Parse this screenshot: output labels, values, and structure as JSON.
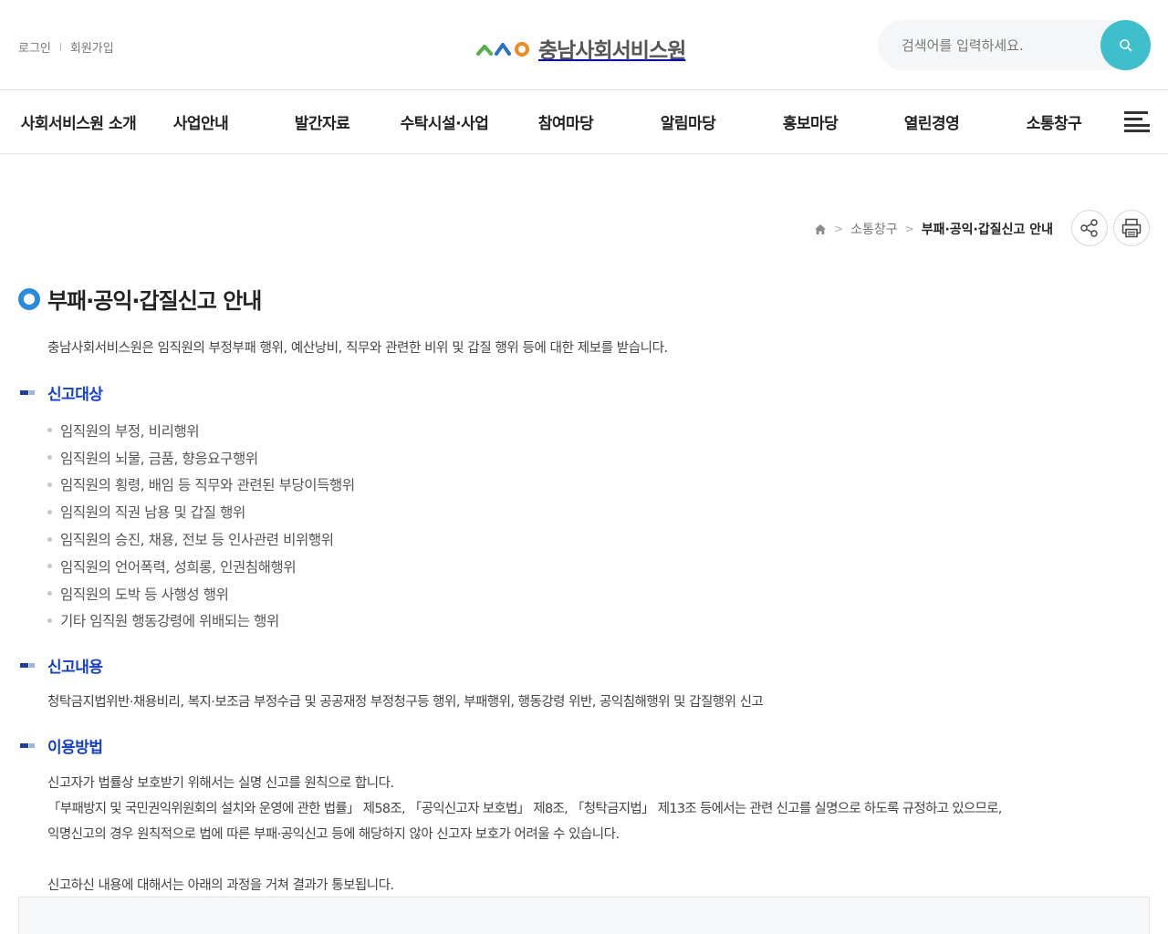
{
  "util": {
    "login": "로그인",
    "signup": "회원가입"
  },
  "logo": {
    "text": "충남사회서비스원",
    "colors": [
      "#55b04c",
      "#2b6fd0",
      "#f08a24"
    ]
  },
  "search": {
    "placeholder": "검색어를 입력하세요.",
    "value": "",
    "icon": "search-icon",
    "button_color": "#3fbfcc"
  },
  "gnb": {
    "items": [
      "사회서비스원 소개",
      "사업안내",
      "발간자료",
      "수탁시설·사업",
      "참여마당",
      "알림마당",
      "홍보마당",
      "열린경영",
      "소통창구"
    ],
    "menu_icon": "hamburger-icon"
  },
  "breadcrumb": {
    "home_icon": "home-icon",
    "parent": "소통창구",
    "current": "부패·공익·갑질신고 안내"
  },
  "tools": {
    "share_icon": "share-icon",
    "print_icon": "print-icon"
  },
  "page": {
    "title": "부패·공익·갑질신고 안내",
    "intro": "충남사회서비스원은 임직원의 부정부패 행위, 예산낭비, 직무와 관련한 비위 및 갑질 행위 등에 대한 제보를 받습니다."
  },
  "sections": {
    "targets": {
      "title": "신고대상",
      "items": [
        "임직원의 부정, 비리행위",
        "임직원의 뇌물, 금품, 향응요구행위",
        "임직원의 횡령, 배임 등 직무와 관련된 부당이득행위",
        "임직원의 직권 남용 및 갑질 행위",
        "임직원의 승진, 채용, 전보 등 인사관련 비위행위",
        "임직원의 언어폭력, 성희롱, 인권침해행위",
        "임직원의 도박 등 사행성 행위",
        "기타 임직원 행동강령에 위배되는 행위"
      ]
    },
    "content": {
      "title": "신고내용",
      "text": "청탁금지법위반·채용비리, 복지·보조금 부정수급 및 공공재정 부정청구등 행위, 부패행위, 행동강령 위반, 공익침해행위 및 갑질행위 신고"
    },
    "usage": {
      "title": "이용방법",
      "lines": [
        "신고자가 법률상 보호받기 위해서는 실명 신고를 원칙으로 합니다.",
        "「부패방지 및 국민권익위원회의 설치와 운영에 관한 법률」 제58조, 「공익신고자 보호법」 제8조, 「청탁금지법」 제13조 등에서는 관련 신고를 실명으로 하도록 규정하고 있으므로,",
        "익명신고의 경우 원칙적으로 법에 따른 부패·공익신고 등에 해당하지 않아 신고자 보호가 어려울 수 있습니다.",
        "신고하신 내용에 대해서는 아래의 과정을 거쳐 결과가 통보됩니다."
      ]
    }
  },
  "colors": {
    "accent_blue": "#1540c8",
    "title_bullet": "#2a8bdb"
  }
}
